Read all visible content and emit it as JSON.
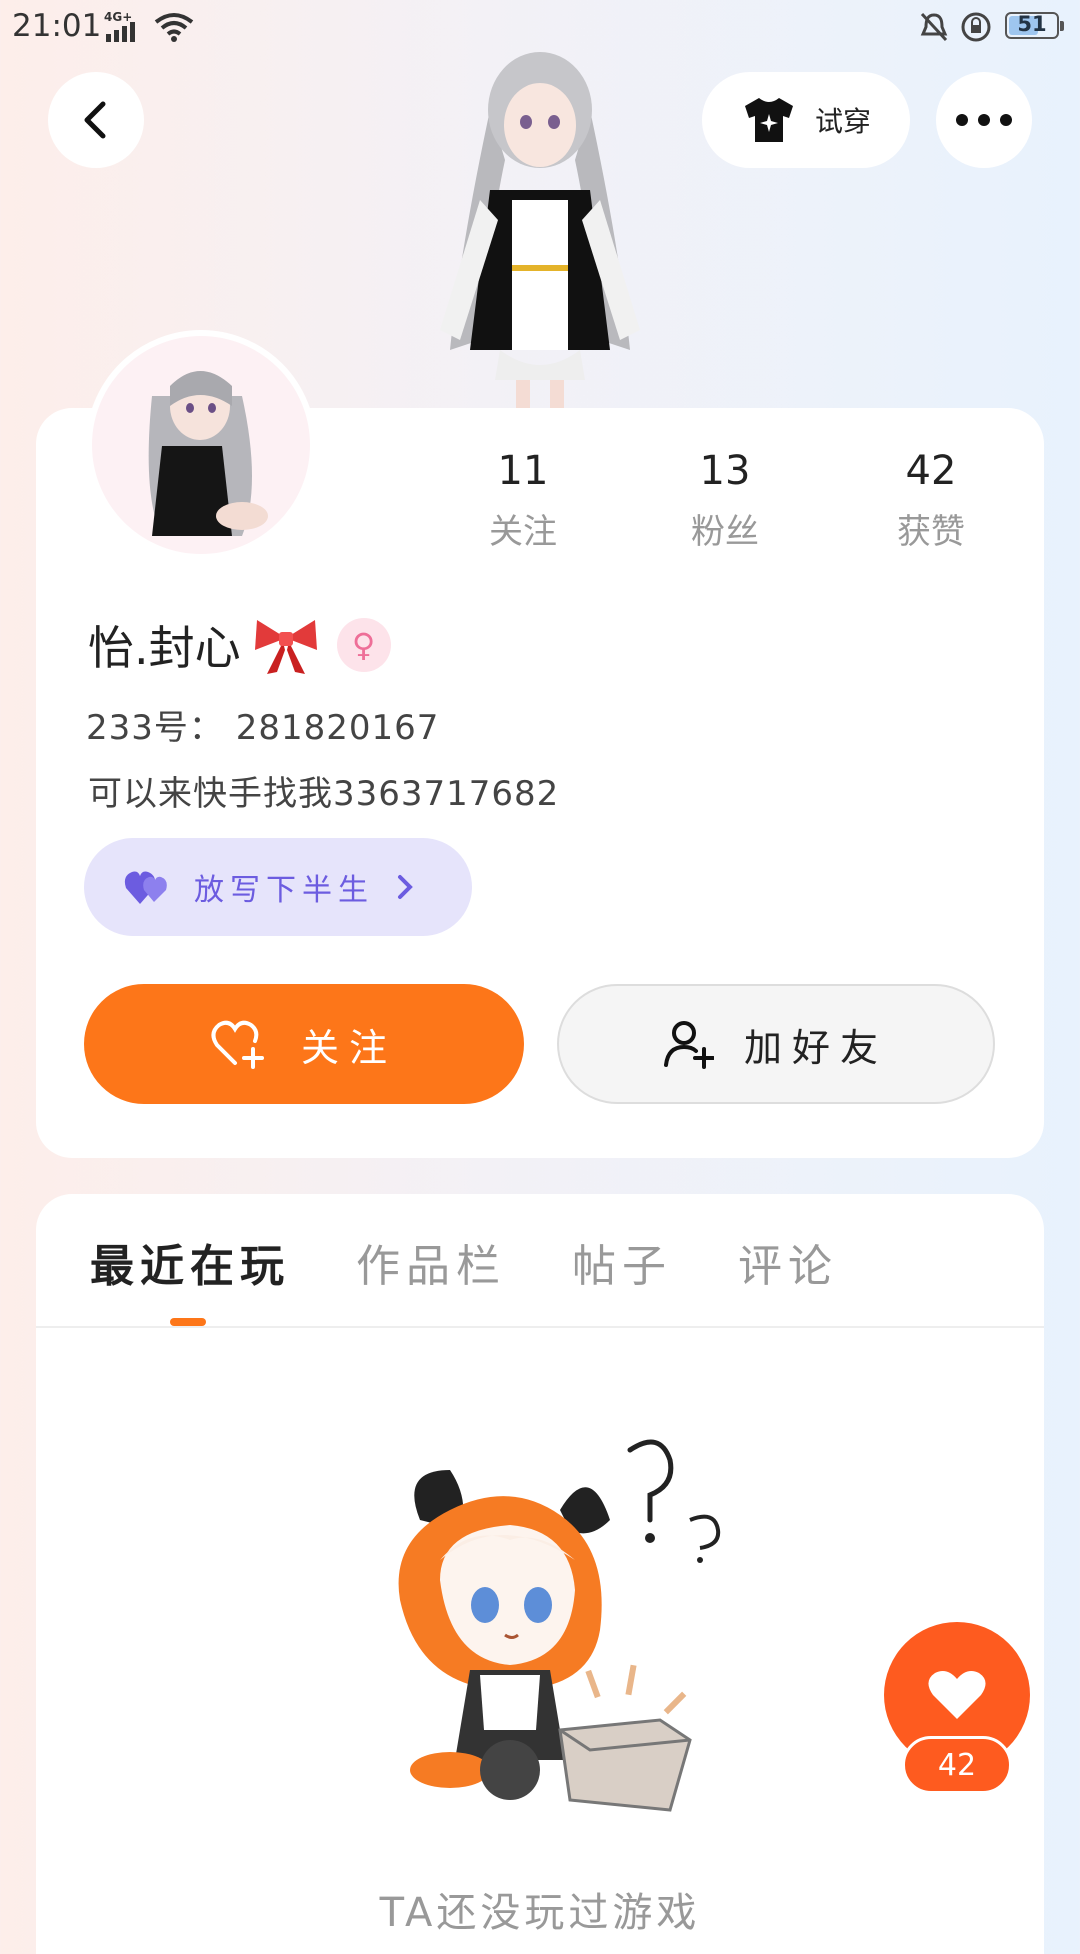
{
  "status_bar": {
    "time": "21:01",
    "network": "4G+",
    "battery": "51"
  },
  "header": {
    "tryon_label": "试穿"
  },
  "stats": [
    {
      "value": "11",
      "label": "关注"
    },
    {
      "value": "13",
      "label": "粉丝"
    },
    {
      "value": "42",
      "label": "获赞"
    }
  ],
  "profile": {
    "nickname": "怡.封心",
    "uid": "233号： 281820167",
    "bio": "可以来快手找我3363717682",
    "group_label": "放写下半生"
  },
  "actions": {
    "follow_label": "关注",
    "add_friend_label": "加好友"
  },
  "tabs": [
    {
      "label": "最近在玩",
      "active": true
    },
    {
      "label": "作品栏",
      "active": false
    },
    {
      "label": "帖子",
      "active": false
    },
    {
      "label": "评论",
      "active": false
    }
  ],
  "empty_state": {
    "text": "TA还没玩过游戏"
  },
  "like": {
    "count": "42"
  },
  "colors": {
    "accent": "#fd7619",
    "like": "#fe5b1f",
    "group_bg": "#e6e4fb",
    "group_text": "#6c5ce0"
  }
}
